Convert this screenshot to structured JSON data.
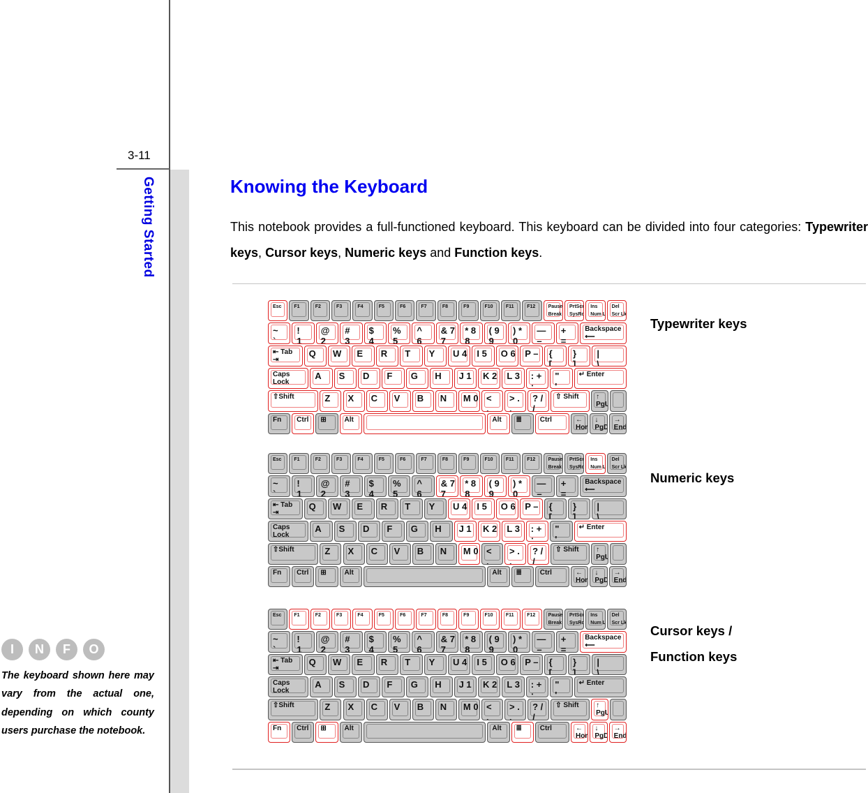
{
  "sidebar": {
    "page_number": "3-11",
    "section_title": "Getting Started",
    "info_logo_letters": [
      "I",
      "N",
      "F",
      "O"
    ],
    "info_note": "The keyboard shown here may vary from the actual one, depending on which county users purchase the notebook."
  },
  "main": {
    "title": "Knowing the Keyboard",
    "intro_prefix": "This notebook provides a full-functioned keyboard.  This keyboard can be divided into four categories: ",
    "intro_terms": [
      "Typewriter keys",
      "Cursor keys",
      "Numeric keys",
      "Function keys"
    ],
    "intro_sep1": ", ",
    "intro_sep2": ", ",
    "intro_sep3": " and ",
    "intro_end": ".",
    "figures": [
      {
        "label_lines": [
          "Typewriter keys"
        ],
        "highlight": "typewriter"
      },
      {
        "label_lines": [
          "Numeric keys"
        ],
        "highlight": "numeric"
      },
      {
        "label_lines": [
          "Cursor keys /",
          "Function keys"
        ],
        "highlight": "cursor"
      }
    ]
  },
  "keyboard": {
    "rows": [
      [
        [
          "Esc",
          1
        ],
        [
          "F1",
          1
        ],
        [
          "F2",
          1
        ],
        [
          "F3",
          1
        ],
        [
          "F4",
          1
        ],
        [
          "F5",
          1
        ],
        [
          "F6",
          1
        ],
        [
          "F7",
          1
        ],
        [
          "F8",
          1
        ],
        [
          "F9",
          1
        ],
        [
          "F10",
          1
        ],
        [
          "F11",
          1
        ],
        [
          "F12",
          1
        ],
        [
          "Pause\nBreak",
          1
        ],
        [
          "PrtScrn\nSysRq",
          1
        ],
        [
          "Ins\nNum Lk",
          1
        ],
        [
          "Del\nScr Lk",
          1
        ]
      ],
      [
        [
          "~\n`",
          1
        ],
        [
          "!\n1",
          1
        ],
        [
          "@\n2",
          1
        ],
        [
          "#\n3",
          1
        ],
        [
          "$\n4",
          1
        ],
        [
          "%\n5",
          1
        ],
        [
          "^\n6",
          1
        ],
        [
          "& 7\n7",
          1
        ],
        [
          "* 8\n8",
          1
        ],
        [
          "( 9\n9",
          1
        ],
        [
          ") *\n0",
          1
        ],
        [
          "—\n–",
          1
        ],
        [
          "+\n=",
          1
        ],
        [
          "Backspace\n⟵",
          2
        ]
      ],
      [
        [
          "⇤ Tab\n⇥",
          1.5
        ],
        [
          "Q",
          1
        ],
        [
          "W",
          1
        ],
        [
          "E",
          1
        ],
        [
          "R",
          1
        ],
        [
          "T",
          1
        ],
        [
          "Y",
          1
        ],
        [
          "U 4",
          1
        ],
        [
          "I 5",
          1
        ],
        [
          "O 6",
          1
        ],
        [
          "P –",
          1
        ],
        [
          "{\n[",
          1
        ],
        [
          "}\n]",
          1
        ],
        [
          "|\n\\",
          1.5
        ]
      ],
      [
        [
          "Caps\nLock",
          1.75
        ],
        [
          "A",
          1
        ],
        [
          "S",
          1
        ],
        [
          "D",
          1
        ],
        [
          "F",
          1
        ],
        [
          "G",
          1
        ],
        [
          "H",
          1
        ],
        [
          "J 1",
          1
        ],
        [
          "K 2",
          1
        ],
        [
          "L 3",
          1
        ],
        [
          ": +\n;",
          1
        ],
        [
          "\"\n'",
          1
        ],
        [
          "↵ Enter",
          2.25
        ]
      ],
      [
        [
          "⇧Shift",
          2.25
        ],
        [
          "Z",
          1
        ],
        [
          "X",
          1
        ],
        [
          "C",
          1
        ],
        [
          "V",
          1
        ],
        [
          "B",
          1
        ],
        [
          "N",
          1
        ],
        [
          "M 0",
          1
        ],
        [
          "<\n,",
          1
        ],
        [
          "> .\n.",
          1
        ],
        [
          "? /\n/",
          1
        ],
        [
          "⇧ Shift",
          1.75
        ],
        [
          "↑\nPgUp",
          0.8
        ],
        [
          "",
          0.8
        ]
      ],
      [
        [
          "Fn",
          1
        ],
        [
          "Ctrl",
          1
        ],
        [
          "⊞",
          1
        ],
        [
          "Alt",
          1
        ],
        [
          "",
          5.2
        ],
        [
          "Alt",
          1
        ],
        [
          "≣",
          1
        ],
        [
          "Ctrl",
          1.5
        ],
        [
          "←\nHome",
          0.8
        ],
        [
          "↓\nPgDn",
          0.8
        ],
        [
          "→\nEnd",
          0.8
        ]
      ]
    ]
  }
}
